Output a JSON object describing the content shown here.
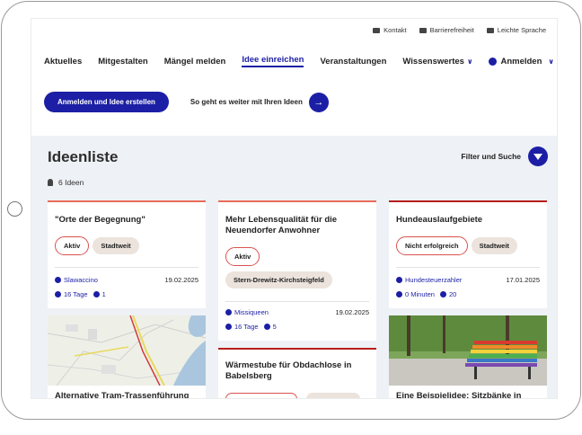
{
  "utility": {
    "contact": "Kontakt",
    "accessibility": "Barrierefreiheit",
    "easy_language": "Leichte Sprache"
  },
  "nav": {
    "items": [
      "Aktuelles",
      "Mitgestalten",
      "Mängel melden",
      "Idee einreichen",
      "Veranstaltungen",
      "Wissenswertes"
    ],
    "login": "Anmelden"
  },
  "cta": {
    "primary": "Anmelden und Idee erstellen",
    "link": "So geht es weiter mit Ihren Ideen"
  },
  "list": {
    "title": "Ideenliste",
    "filter": "Filter und Suche",
    "count": "6 Ideen"
  },
  "cards": [
    {
      "title": "\"Orte der Begegnung\"",
      "chips": [
        "Aktiv",
        "Stadtweit"
      ],
      "author": "Slawaccino",
      "date": "19.02.2025",
      "duration": "16 Tage",
      "supporters": "1"
    },
    {
      "title": "Mehr Lebensqualität für die Neuendorfer Anwohner",
      "chips": [
        "Aktiv",
        "Stern-Drewitz-Kirchsteigfeld"
      ],
      "author": "Missiqueen",
      "date": "19.02.2025",
      "duration": "16 Tage",
      "supporters": "5"
    },
    {
      "title": "Hundeauslaufgebiete",
      "chips": [
        "Nicht erfolgreich",
        "Stadtweit"
      ],
      "author": "Hundesteuerzahler",
      "date": "17.01.2025",
      "duration": "0 Minuten",
      "supporters": "20"
    },
    {
      "title": "Alternative Tram-Trassenführung"
    },
    {
      "title": "Wärmestube für Obdachlose in Babelsberg"
    },
    {
      "title": "Eine Beispielidee: Sitzbänke in"
    }
  ],
  "colors": {
    "primary": "#1c1fa5",
    "accent_red": "#b81d1d",
    "accent_orange": "#e86c5a"
  }
}
